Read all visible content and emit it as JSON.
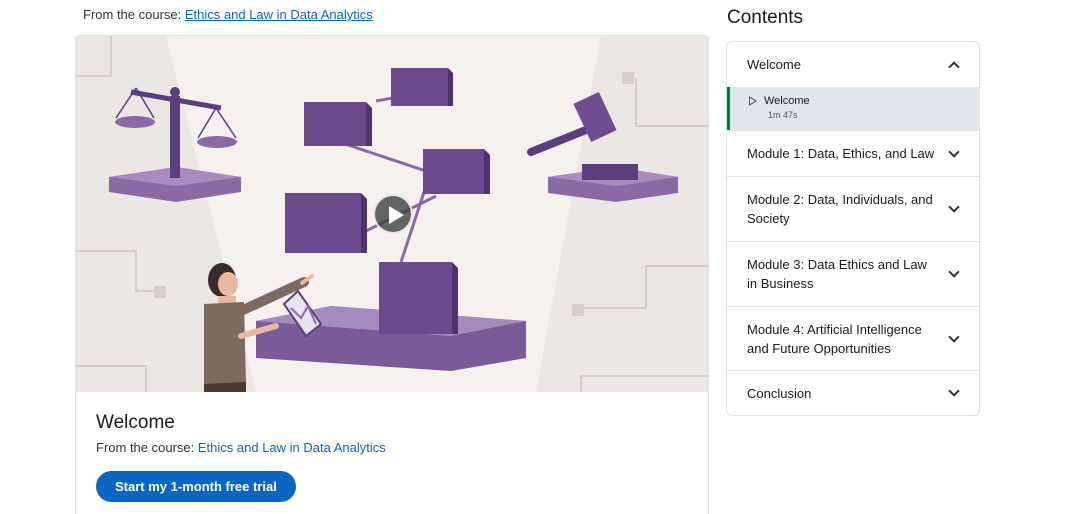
{
  "course": {
    "from_prefix": "From the course: ",
    "title": "Ethics and Law in Data Analytics"
  },
  "video": {
    "play_label": "Play"
  },
  "lesson_info": {
    "title": "Welcome",
    "from_prefix": "From the course: ",
    "course_link": "Ethics and Law in Data Analytics",
    "cta_label": "Start my 1-month free trial"
  },
  "contents": {
    "heading": "Contents",
    "sections": [
      {
        "label": "Welcome",
        "expanded": true,
        "lessons": [
          {
            "title": "Welcome",
            "duration": "1m 47s"
          }
        ]
      },
      {
        "label": "Module 1: Data, Ethics, and Law",
        "expanded": false
      },
      {
        "label": "Module 2: Data, Individuals, and Society",
        "expanded": false
      },
      {
        "label": "Module 3: Data Ethics and Law in Business",
        "expanded": false
      },
      {
        "label": "Module 4: Artificial Intelligence and Future Opportunities",
        "expanded": false
      },
      {
        "label": "Conclusion",
        "expanded": false
      }
    ]
  },
  "colors": {
    "link": "#0a66c2",
    "primary_button": "#0a66c2",
    "active_lesson_bg": "#e1e6ec",
    "active_lesson_border": "#057642",
    "illustration_purple": "#5b3f7d"
  }
}
